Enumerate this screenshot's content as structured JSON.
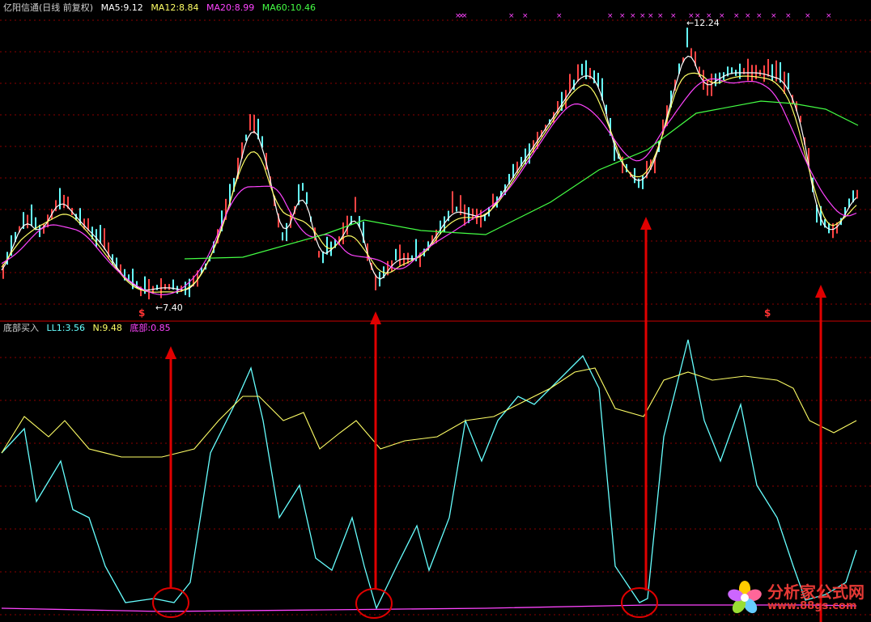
{
  "top_panel": {
    "title": "亿阳信通(日线 前复权)",
    "title_color": "#d0d0d0",
    "ma5": "MA5:9.12",
    "ma5_color": "#ffffff",
    "ma12": "MA12:8.84",
    "ma12_color": "#ffff66",
    "ma20": "MA20:8.99",
    "ma20_color": "#ff44ff",
    "ma60": "MA60:10.46",
    "ma60_color": "#44ff44",
    "low_marker": "7.40",
    "high_marker": "12.24",
    "signal_marks": [
      "$",
      "$"
    ]
  },
  "bottom_panel": {
    "title": "底部买入",
    "title_color": "#d0d0d0",
    "ll1": "LL1:3.56",
    "ll1_color": "#66ffff",
    "n": "N:9.48",
    "n_color": "#ffff66",
    "bottom": "底部:0.85",
    "bottom_color": "#ff44ff"
  },
  "colors": {
    "up": "#ff4444",
    "down": "#66ffff",
    "grid": "#8b0000",
    "divider": "#cc0000",
    "arrow": "#e00000",
    "circle": "#e00000",
    "flag": "#ff44ff"
  },
  "watermark": {
    "cn": "分析家公式网",
    "url": "www.88gs.com",
    "icon": "flower-logo-icon"
  }
}
